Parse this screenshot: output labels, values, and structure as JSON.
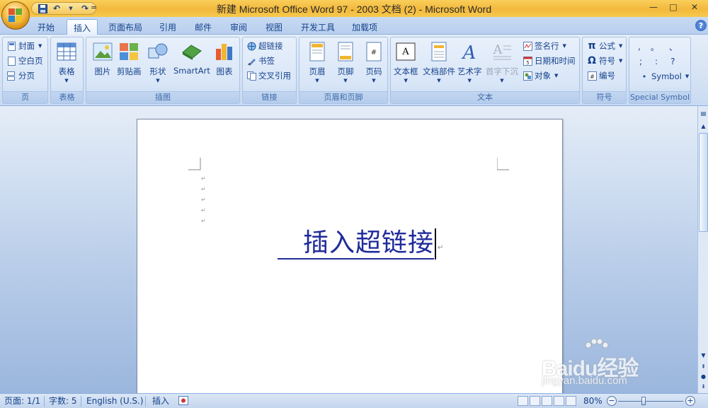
{
  "window": {
    "title": "新建 Microsoft Office Word 97 - 2003 文档 (2) - Microsoft Word",
    "controls": {
      "minimize": "—",
      "maximize": "□",
      "close": "✕"
    }
  },
  "qat": {
    "save_icon": "save-icon",
    "undo_icon": "undo-icon",
    "redo_icon": "redo-icon",
    "customize": "="
  },
  "tabs": [
    {
      "label": "开始"
    },
    {
      "label": "插入",
      "active": true
    },
    {
      "label": "页面布局"
    },
    {
      "label": "引用"
    },
    {
      "label": "邮件"
    },
    {
      "label": "审阅"
    },
    {
      "label": "视图"
    },
    {
      "label": "开发工具"
    },
    {
      "label": "加载项"
    }
  ],
  "ribbon": {
    "pages": {
      "label": "页",
      "items": [
        "封面",
        "空白页",
        "分页"
      ]
    },
    "tables": {
      "label": "表格",
      "table": "表格"
    },
    "illustrations": {
      "label": "插图",
      "items": [
        "图片",
        "剪贴画",
        "形状",
        "SmartArt",
        "图表"
      ]
    },
    "links": {
      "label": "链接",
      "items": [
        "超链接",
        "书签",
        "交叉引用"
      ]
    },
    "header_footer": {
      "label": "页眉和页脚",
      "items": [
        "页眉",
        "页脚",
        "页码"
      ]
    },
    "text": {
      "label": "文本",
      "items": [
        "文本框",
        "文档部件",
        "艺术字",
        "首字下沉"
      ],
      "small_items": [
        "签名行",
        "日期和时间",
        "对象"
      ]
    },
    "symbols": {
      "label": "符号",
      "items": [
        "公式",
        "符号",
        "编号"
      ]
    },
    "special": {
      "label": "Special Symbol",
      "row1": [
        ",",
        "。",
        "、"
      ],
      "row2": [
        ";",
        ":",
        "?"
      ],
      "symbol": "Symbol"
    }
  },
  "document": {
    "hyperlink_text": "插入超链接"
  },
  "statusbar": {
    "page": "页面: 1/1",
    "words": "字数: 5",
    "language": "English (U.S.)",
    "mode": "插入",
    "zoom": "80%",
    "zoom_minus": "−",
    "zoom_plus": "+"
  },
  "watermark": {
    "brand": "Baidu经验",
    "url": "jingyan.baidu.com"
  },
  "colors": {
    "ribbon_text": "#15428b",
    "title_bar": "#f3b93c",
    "hyperlink": "#1f2b9a"
  }
}
